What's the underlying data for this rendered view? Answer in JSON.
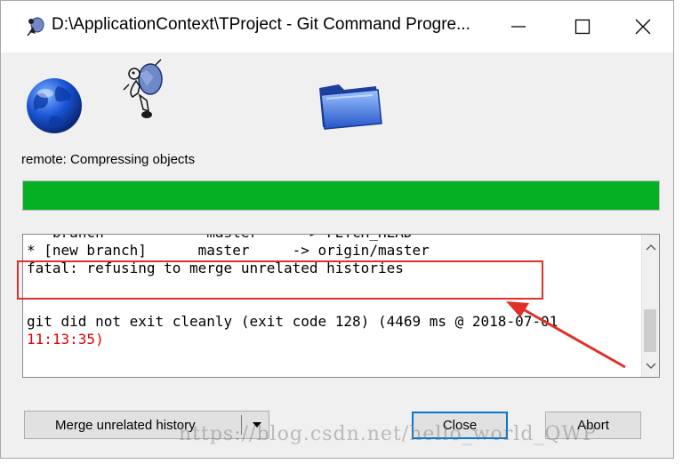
{
  "window": {
    "title": "D:\\ApplicationContext\\TProject - Git Command Progre..."
  },
  "controls": {
    "minimize_icon": "minimize-icon",
    "maximize_icon": "maximize-icon",
    "close_icon": "close-icon"
  },
  "icons": {
    "globe": "globe-icon",
    "tortoise": "tortoise-icon",
    "folder": "folder-icon"
  },
  "status": {
    "text": "remote: Compressing objects",
    "progress": 1.0,
    "progress_color": "#06b025"
  },
  "log": {
    "lines": [
      {
        "text": " * branch            master     -> FETCH_HEAD",
        "color": "black"
      },
      {
        "text": "* [new branch]      master     -> origin/master",
        "color": "black"
      },
      {
        "text": "fatal: refusing to merge unrelated histories",
        "color": "black"
      },
      {
        "text": "",
        "color": "black"
      },
      {
        "text": "",
        "color": "black"
      },
      {
        "text": "git did not exit cleanly (exit code 128) (4469 ms @ 2018-07-01",
        "color": "black"
      },
      {
        "text": "11:13:35)",
        "color": "red"
      }
    ]
  },
  "annotation": {
    "highlight_color": "#e0302a"
  },
  "buttons": {
    "merge_label": "Merge unrelated history",
    "close_label": "Close",
    "abort_label": "Abort"
  },
  "watermark": {
    "text": "https://blog.csdn.net/hello_world_QWP"
  }
}
